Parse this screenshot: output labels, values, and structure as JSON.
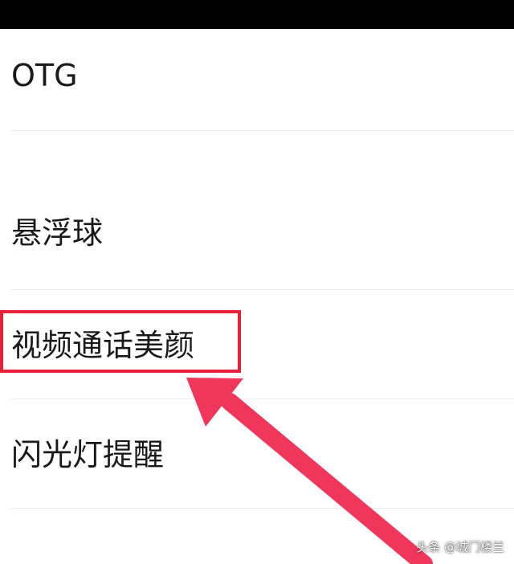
{
  "settings": {
    "items": [
      {
        "label": "OTG"
      },
      {
        "label": "悬浮球"
      },
      {
        "label": "视频通话美颜"
      },
      {
        "label": "闪光灯提醒"
      }
    ]
  },
  "watermark": {
    "text": "头条 @城门楼兰"
  },
  "colors": {
    "highlight": "#e8203a",
    "arrow": "#f0365a"
  }
}
